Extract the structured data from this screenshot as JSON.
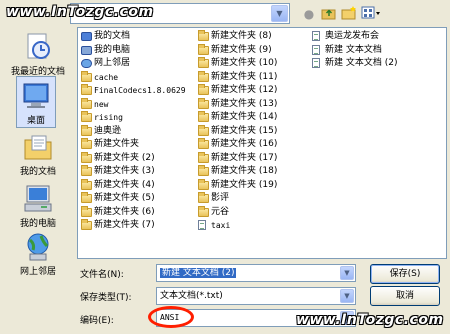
{
  "watermark": "www.InTozgc.com",
  "toolbar": {
    "lookin_value": "",
    "icons": [
      "back-icon",
      "up-folder-icon",
      "new-folder-icon",
      "view-menu-icon"
    ]
  },
  "places": [
    {
      "label": "我最近的文档",
      "icon": "recent-docs-icon"
    },
    {
      "label": "桌面",
      "icon": "desktop-icon"
    },
    {
      "label": "我的文档",
      "icon": "my-documents-icon"
    },
    {
      "label": "我的电脑",
      "icon": "my-computer-icon"
    },
    {
      "label": "网上邻居",
      "icon": "network-icon"
    }
  ],
  "files": {
    "col1": [
      {
        "name": "我的文档",
        "type": "special"
      },
      {
        "name": "我的电脑",
        "type": "pc"
      },
      {
        "name": "网上邻居",
        "type": "net"
      },
      {
        "name": "cache",
        "type": "folder"
      },
      {
        "name": "FinalCodecs1.8.0629",
        "type": "folder"
      },
      {
        "name": "new",
        "type": "folder"
      },
      {
        "name": "rising",
        "type": "folder"
      },
      {
        "name": "迪奥逊",
        "type": "folder"
      },
      {
        "name": "新建文件夹",
        "type": "folder"
      },
      {
        "name": "新建文件夹 (2)",
        "type": "folder"
      },
      {
        "name": "新建文件夹 (3)",
        "type": "folder"
      },
      {
        "name": "新建文件夹 (4)",
        "type": "folder"
      },
      {
        "name": "新建文件夹 (5)",
        "type": "folder"
      },
      {
        "name": "新建文件夹 (6)",
        "type": "folder"
      },
      {
        "name": "新建文件夹 (7)",
        "type": "folder"
      }
    ],
    "col2": [
      {
        "name": "新建文件夹 (8)",
        "type": "folder"
      },
      {
        "name": "新建文件夹 (9)",
        "type": "folder"
      },
      {
        "name": "新建文件夹 (10)",
        "type": "folder"
      },
      {
        "name": "新建文件夹 (11)",
        "type": "folder"
      },
      {
        "name": "新建文件夹 (12)",
        "type": "folder"
      },
      {
        "name": "新建文件夹 (13)",
        "type": "folder"
      },
      {
        "name": "新建文件夹 (14)",
        "type": "folder"
      },
      {
        "name": "新建文件夹 (15)",
        "type": "folder"
      },
      {
        "name": "新建文件夹 (16)",
        "type": "folder"
      },
      {
        "name": "新建文件夹 (17)",
        "type": "folder"
      },
      {
        "name": "新建文件夹 (18)",
        "type": "folder"
      },
      {
        "name": "新建文件夹 (19)",
        "type": "folder"
      },
      {
        "name": "影评",
        "type": "folder"
      },
      {
        "name": "元谷",
        "type": "folder"
      },
      {
        "name": "taxi",
        "type": "doc"
      }
    ],
    "col3": [
      {
        "name": "奥运龙发布会",
        "type": "doc"
      },
      {
        "name": "新建 文本文档",
        "type": "doc"
      },
      {
        "name": "新建 文本文档 (2)",
        "type": "doc"
      }
    ]
  },
  "form": {
    "filename_label": "文件名(N):",
    "filename_value": "新建 文本文档 (2)",
    "filetype_label": "保存类型(T):",
    "filetype_value": "文本文档(*.txt)",
    "encoding_label": "编码(E):",
    "encoding_value": "ANSI",
    "save_button": "保存(S)",
    "cancel_button": "取消"
  },
  "colors": {
    "highlight": "#316ac5",
    "annotation_circle": "#ff1e00"
  }
}
